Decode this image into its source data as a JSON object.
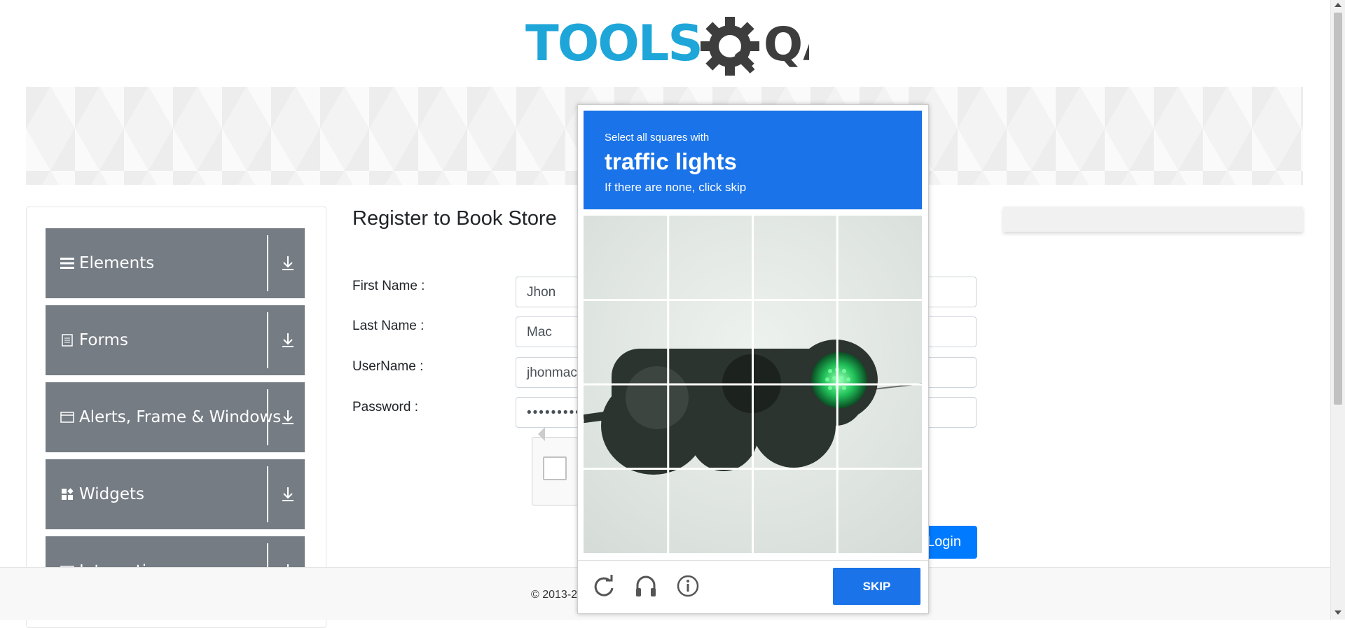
{
  "logo": {
    "text_tools": "TOOLS",
    "text_qa": "QA"
  },
  "sidebar": {
    "groups": [
      {
        "label": "Elements",
        "icon": "hamburger-icon"
      },
      {
        "label": "Forms",
        "icon": "document-icon"
      },
      {
        "label": "Alerts, Frame & Windows",
        "icon": "window-icon"
      },
      {
        "label": "Widgets",
        "icon": "widgets-icon"
      },
      {
        "label": "Interactions",
        "icon": "interactions-icon"
      }
    ]
  },
  "form": {
    "title": "Register to Book Store",
    "first_name_label": "First Name :",
    "first_name_value": "Jhon",
    "last_name_label": "Last Name :",
    "last_name_value": "Mac",
    "username_label": "UserName :",
    "username_value": "jhonmac",
    "password_label": "Password :",
    "password_value": "•••••••••",
    "login_label": "Login"
  },
  "footer": {
    "text": "© 2013-2"
  },
  "captcha": {
    "instruction": "Select all squares with",
    "target": "traffic lights",
    "hint": "If there are none, click skip",
    "skip_label": "SKIP",
    "header_color": "#1a73e8",
    "icons": [
      "reload-icon",
      "audio-icon",
      "info-icon"
    ]
  },
  "colors": {
    "sidebar_group": "#757c84",
    "login": "#007bff",
    "logo_blue": "#1ea6d9",
    "logo_dark": "#3d3d3d"
  }
}
